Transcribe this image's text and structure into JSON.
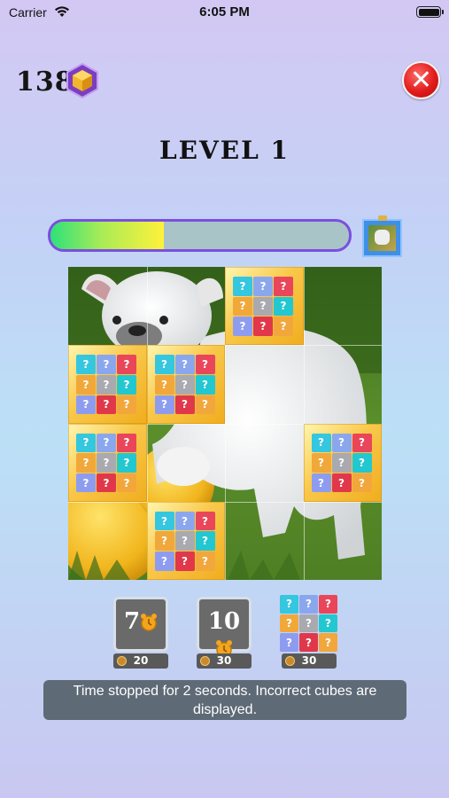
{
  "status_bar": {
    "carrier": "Carrier",
    "time": "6:05 PM"
  },
  "hud": {
    "coins": "138"
  },
  "level": {
    "title": "LEVEL 1"
  },
  "progress": {
    "fraction": 0.38
  },
  "board": {
    "rows": 4,
    "cols": 4,
    "cube_tiles": [
      [
        0,
        2
      ],
      [
        1,
        0
      ],
      [
        1,
        1
      ],
      [
        2,
        0
      ],
      [
        2,
        3
      ],
      [
        3,
        1
      ]
    ]
  },
  "cube_colors": [
    "#35c6e0",
    "#8aa7ee",
    "#e9465a",
    "#f1a83a",
    "#a9a9b0",
    "#23c7d0",
    "#8e9cf0",
    "#e0384a",
    "#f2a73c"
  ],
  "boosters": [
    {
      "value": "7",
      "cost": "20"
    },
    {
      "value": "10",
      "cost": "30"
    },
    {
      "cost": "30"
    }
  ],
  "toast": {
    "line1": "Time stopped for 2 seconds. Incorrect cubes are",
    "line2": "displayed."
  }
}
